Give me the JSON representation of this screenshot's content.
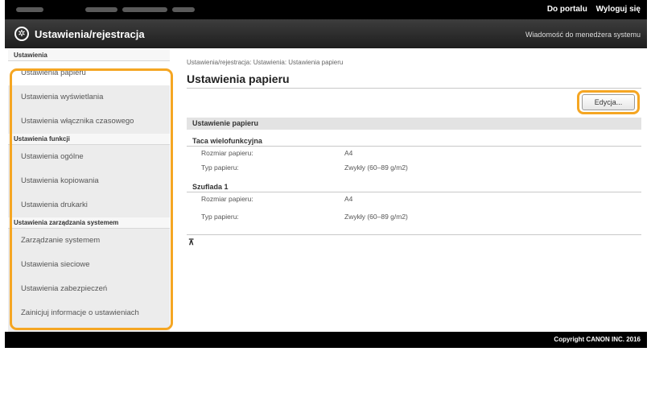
{
  "topbar": {
    "link_portal": "Do portalu",
    "link_logout": "Wyloguj się"
  },
  "header": {
    "title": "Ustawienia/rejestracja",
    "admin_message": "Wiadomość do menedżera systemu"
  },
  "sidebar": {
    "section1": {
      "heading": "Ustawienia",
      "items": [
        {
          "label": "Ustawienia papieru"
        },
        {
          "label": "Ustawienia wyświetlania"
        },
        {
          "label": "Ustawienia włącznika czasowego"
        }
      ]
    },
    "section2": {
      "heading": "Ustawienia funkcji",
      "items": [
        {
          "label": "Ustawienia ogólne"
        },
        {
          "label": "Ustawienia kopiowania"
        },
        {
          "label": "Ustawienia drukarki"
        }
      ]
    },
    "section3": {
      "heading": "Ustawienia zarządzania systemem",
      "items": [
        {
          "label": "Zarządzanie systemem"
        },
        {
          "label": "Ustawienia sieciowe"
        },
        {
          "label": "Ustawienia zabezpieczeń"
        },
        {
          "label": "Zainicjuj informacje o ustawieniach"
        }
      ]
    }
  },
  "main": {
    "breadcrumb": "Ustawienia/rejestracja: Ustawienia: Ustawienia papieru",
    "title": "Ustawienia papieru",
    "edit_label": "Edycja...",
    "section_title": "Ustawienie papieru",
    "groups": [
      {
        "name": "Taca wielofunkcyjna",
        "rows": [
          {
            "label": "Rozmiar papieru:",
            "value": "A4"
          },
          {
            "label": "Typ papieru:",
            "value": "Zwykły (60–89 g/m2)"
          }
        ]
      },
      {
        "name": "Szuflada 1",
        "rows": [
          {
            "label": "Rozmiar papieru:",
            "value": "A4"
          },
          {
            "label": "Typ papieru:",
            "value": "Zwykły (60–89 g/m2)"
          }
        ]
      }
    ],
    "top_icon": "back-to-top-icon"
  },
  "footer": {
    "copyright": "Copyright CANON INC. 2016"
  },
  "colors": {
    "highlight": "#f5a623",
    "bar": "#000000"
  }
}
